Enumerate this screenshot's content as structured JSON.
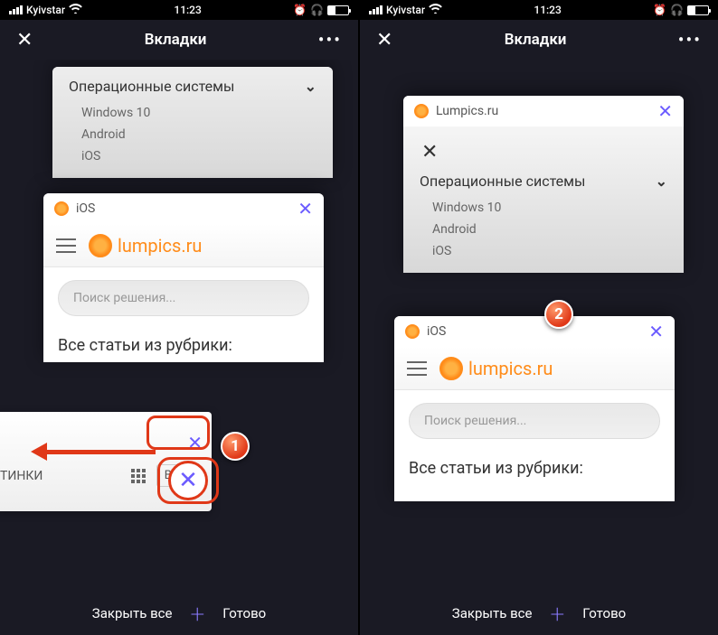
{
  "statusbar": {
    "carrier": "Kyivstar",
    "time": "11:23"
  },
  "navbar": {
    "title": "Вкладки",
    "close": "✕",
    "more": "•••"
  },
  "menu": {
    "heading": "Операционные системы",
    "items": [
      "Windows 10",
      "Android",
      "iOS"
    ]
  },
  "tabs": {
    "lumpics": {
      "title": "Lumpics.ru"
    },
    "ios": {
      "title": "iOS"
    }
  },
  "site": {
    "name": "lumpics.ru",
    "search_placeholder": "Поиск решения...",
    "section_heading": "Все статьи из рубрики:"
  },
  "swipe_card": {
    "partial_text": "ТИНКИ",
    "login": "Войт"
  },
  "bottombar": {
    "close_all": "Закрыть все",
    "done": "Готово"
  },
  "callouts": {
    "one": "1",
    "two": "2"
  }
}
